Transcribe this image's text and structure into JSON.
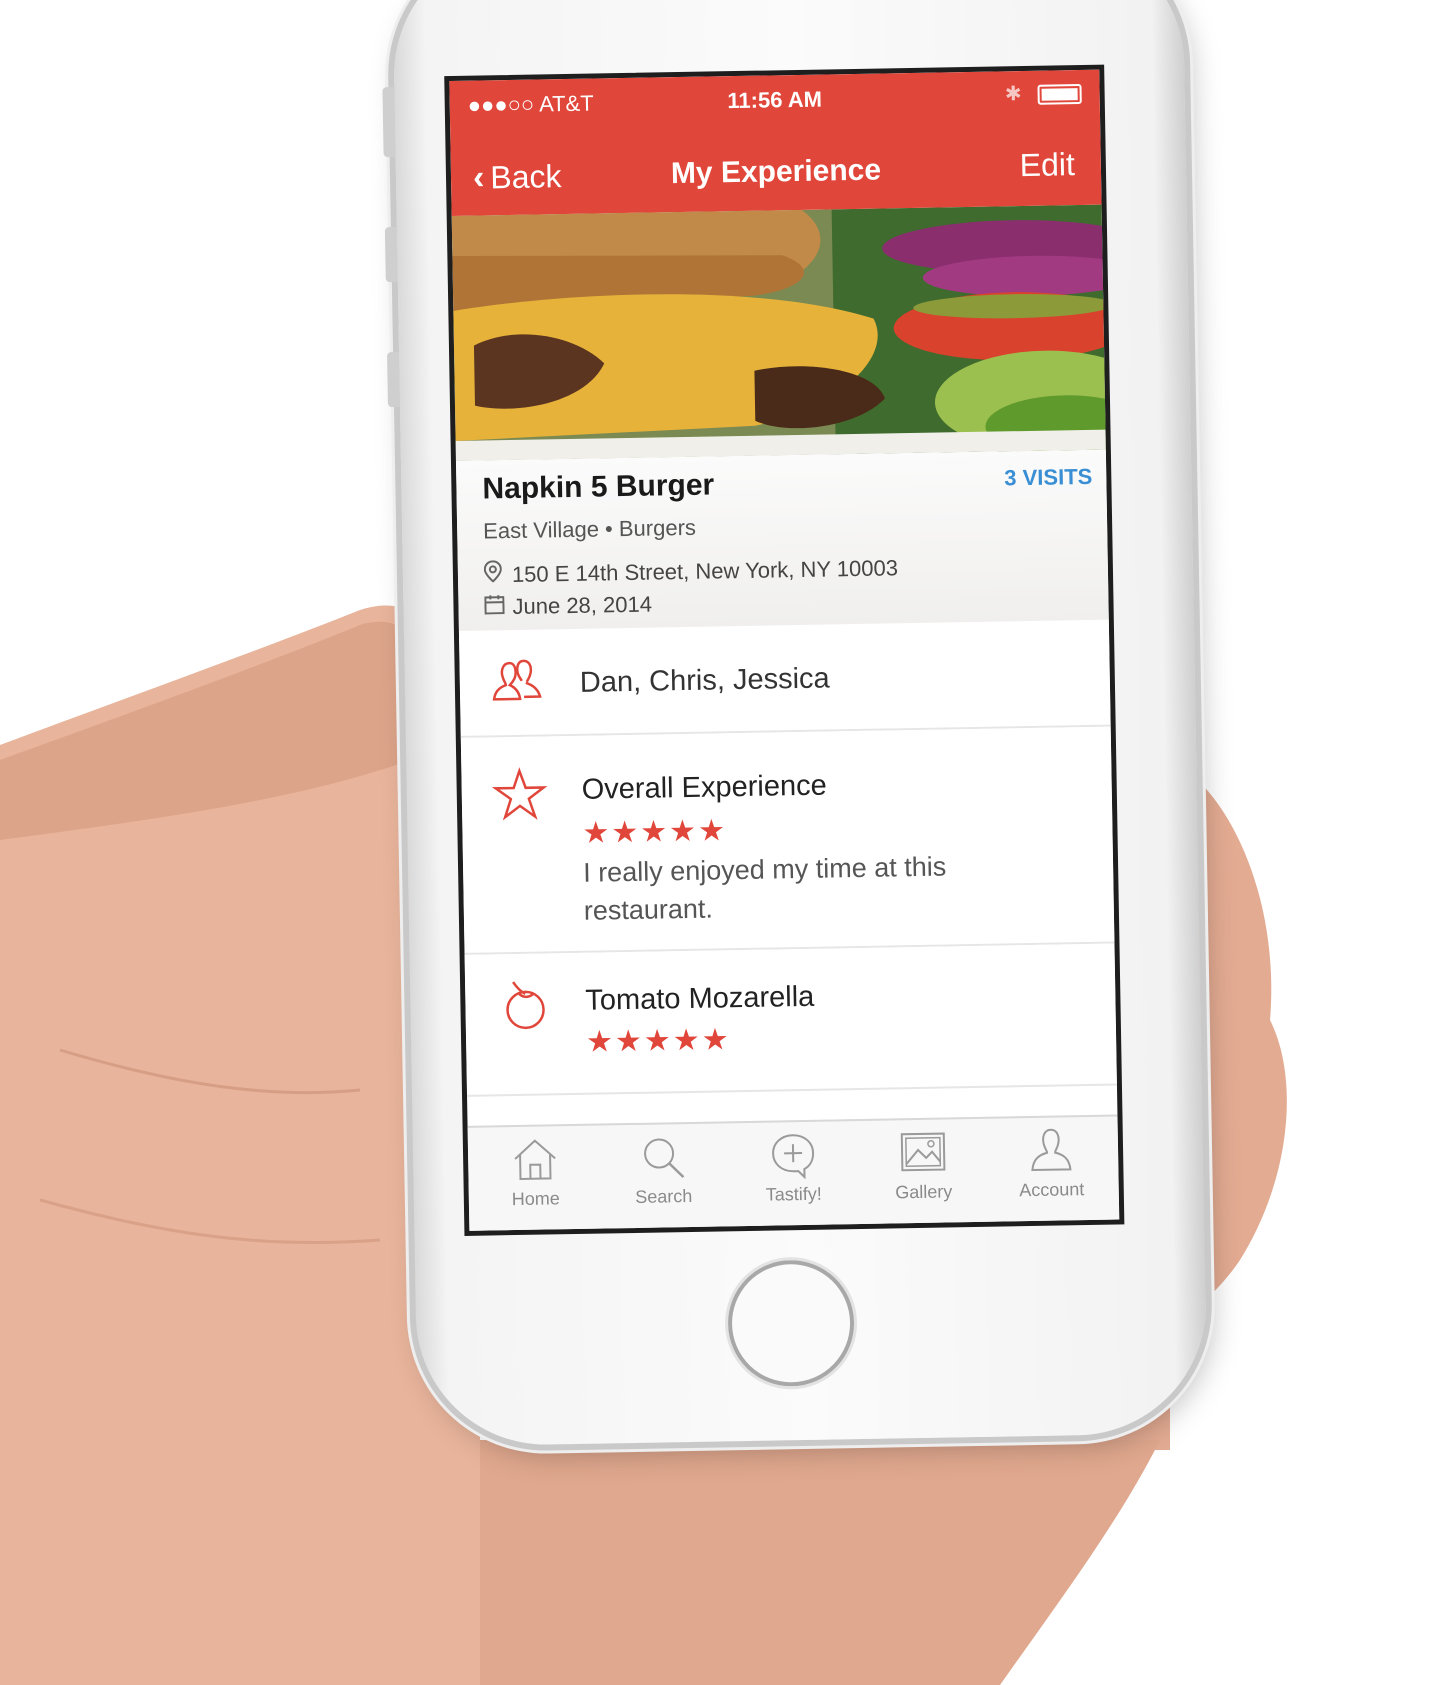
{
  "status_bar": {
    "carrier": "●●●○○ AT&T",
    "time": "11:56 AM"
  },
  "nav": {
    "back_label": "Back",
    "title": "My Experience",
    "edit_label": "Edit"
  },
  "restaurant": {
    "name": "Napkin 5 Burger",
    "visits": "3 VISITS",
    "category": "East Village • Burgers",
    "address": "150 E 14th Street, New York, NY 10003",
    "date": "June 28, 2014"
  },
  "companions": {
    "names": "Dan, Chris, Jessica",
    "icon": "people-icon"
  },
  "overall": {
    "label": "Overall Experience",
    "rating": 5,
    "stars": "★★★★★",
    "comment": "I really enjoyed my time at this restaurant.",
    "icon": "star-outline-icon"
  },
  "dish": {
    "label": "Tomato Mozarella",
    "rating": 5,
    "stars": "★★★★★",
    "icon": "tomato-icon"
  },
  "tabs": [
    {
      "label": "Home",
      "icon": "home-icon"
    },
    {
      "label": "Search",
      "icon": "search-icon"
    },
    {
      "label": "Tastify!",
      "icon": "add-chat-icon"
    },
    {
      "label": "Gallery",
      "icon": "gallery-icon"
    },
    {
      "label": "Account",
      "icon": "account-icon"
    }
  ],
  "colors": {
    "brand_red": "#e1463a",
    "visits_blue": "#3a8fd4"
  }
}
